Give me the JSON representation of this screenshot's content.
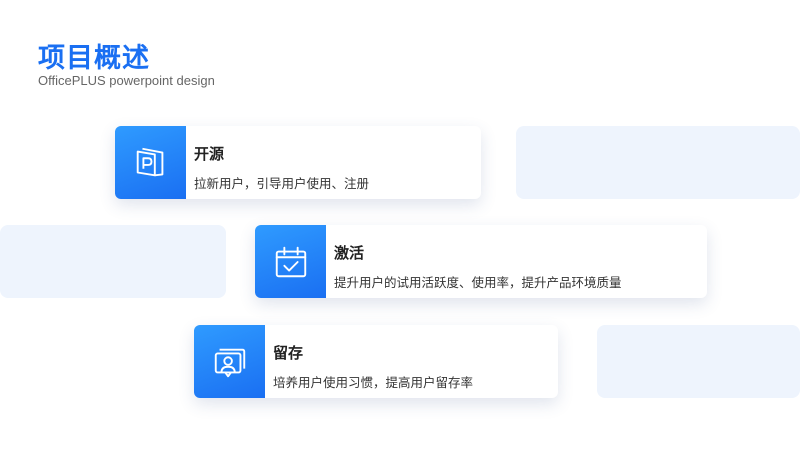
{
  "header": {
    "title": "项目概述",
    "subtitle": "OfficePLUS powerpoint design"
  },
  "colors": {
    "accent": "#1a6ff2",
    "accent_light": "#2f9bff",
    "panel_bg": "#eef4fd"
  },
  "cards": [
    {
      "title": "开源",
      "desc": "拉新用户，引导用户使用、注册",
      "icon": "powerpoint-icon"
    },
    {
      "title": "激活",
      "desc": "提升用户的试用活跃度、使用率，提升产品环境质量",
      "icon": "calendar-check-icon"
    },
    {
      "title": "留存",
      "desc": "培养用户使用习惯，提高用户留存率",
      "icon": "user-card-icon"
    }
  ]
}
